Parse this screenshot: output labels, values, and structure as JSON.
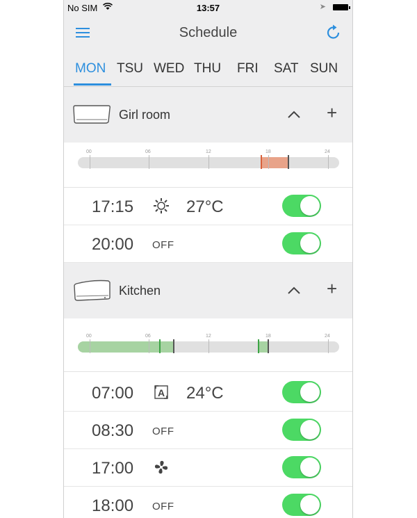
{
  "status": {
    "carrier": "No SIM",
    "time": "13:57"
  },
  "header": {
    "title": "Schedule"
  },
  "tabs": [
    {
      "label": "MON",
      "active": true
    },
    {
      "label": "TSU"
    },
    {
      "label": "WED"
    },
    {
      "label": "THU"
    },
    {
      "label": "FRI"
    },
    {
      "label": "SAT"
    },
    {
      "label": "SUN"
    }
  ],
  "timeline_hours": [
    "00",
    "06",
    "12",
    "18",
    "24"
  ],
  "groups": [
    {
      "name": "Girl room",
      "timeline": {
        "fill_color": "#e8a389",
        "segments": [
          {
            "start": "17:15",
            "end": "20:00"
          }
        ]
      },
      "entries": [
        {
          "time": "17:15",
          "mode_icon": "sun-icon",
          "temp": "27°C",
          "enabled": true
        },
        {
          "time": "20:00",
          "mode": "OFF",
          "enabled": true
        }
      ]
    },
    {
      "name": "Kitchen",
      "timeline": {
        "fill_color": "#a7d3a2",
        "segments": [
          {
            "start": "00:00",
            "end": "08:30"
          },
          {
            "start": "17:00",
            "end": "18:00"
          }
        ]
      },
      "entries": [
        {
          "time": "07:00",
          "mode_icon": "auto-mode-icon",
          "temp": "24°C",
          "enabled": true
        },
        {
          "time": "08:30",
          "mode": "OFF",
          "enabled": true
        },
        {
          "time": "17:00",
          "mode_icon": "fan-icon",
          "enabled": true
        },
        {
          "time": "18:00",
          "mode": "OFF",
          "enabled": true
        }
      ]
    }
  ],
  "colors": {
    "accent": "#2d8fde",
    "toggle_on": "#4cd964",
    "header_bg": "#eeeeef"
  }
}
